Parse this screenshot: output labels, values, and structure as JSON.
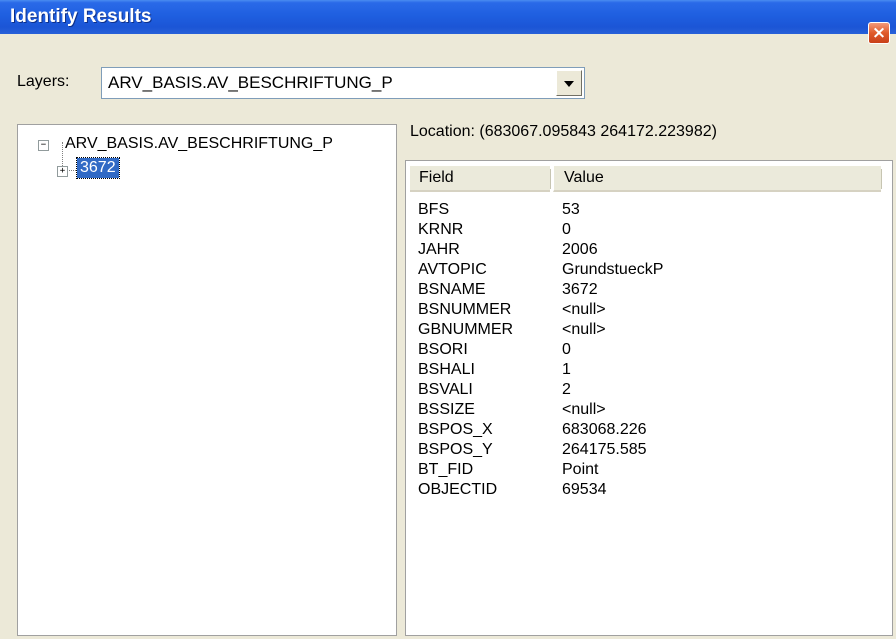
{
  "window": {
    "title": "Identify Results",
    "close_icon": "close-icon",
    "close_symbol": "×"
  },
  "layers": {
    "label": "Layers:",
    "selected": "ARV_BASIS.AV_BESCHRIFTUNG_P"
  },
  "tree": {
    "root_label": "ARV_BASIS.AV_BESCHRIFTUNG_P",
    "root_expander": "−",
    "child_label": "3672",
    "child_expander": "+"
  },
  "location": "Location: (683067.095843 264172.223982)",
  "table": {
    "headers": {
      "field": "Field",
      "value": "Value"
    },
    "rows": [
      {
        "field": "BFS",
        "value": "53"
      },
      {
        "field": "KRNR",
        "value": "0"
      },
      {
        "field": "JAHR",
        "value": "2006"
      },
      {
        "field": "AVTOPIC",
        "value": "GrundstueckP"
      },
      {
        "field": "BSNAME",
        "value": "3672"
      },
      {
        "field": "BSNUMMER",
        "value": "<null>"
      },
      {
        "field": "GBNUMMER",
        "value": "<null>"
      },
      {
        "field": "BSORI",
        "value": "0"
      },
      {
        "field": "BSHALI",
        "value": "1"
      },
      {
        "field": "BSVALI",
        "value": "2"
      },
      {
        "field": "BSSIZE",
        "value": "<null>"
      },
      {
        "field": "BSPOS_X",
        "value": "683068.226"
      },
      {
        "field": "BSPOS_Y",
        "value": "264175.585"
      },
      {
        "field": "BT_FID",
        "value": "Point"
      },
      {
        "field": "OBJECTID",
        "value": "69534"
      }
    ]
  },
  "colors": {
    "titlebar": "#1f5fe0",
    "selection": "#316ac5",
    "dialog_bg": "#ece9d8",
    "close_button": "#e05a2a"
  }
}
